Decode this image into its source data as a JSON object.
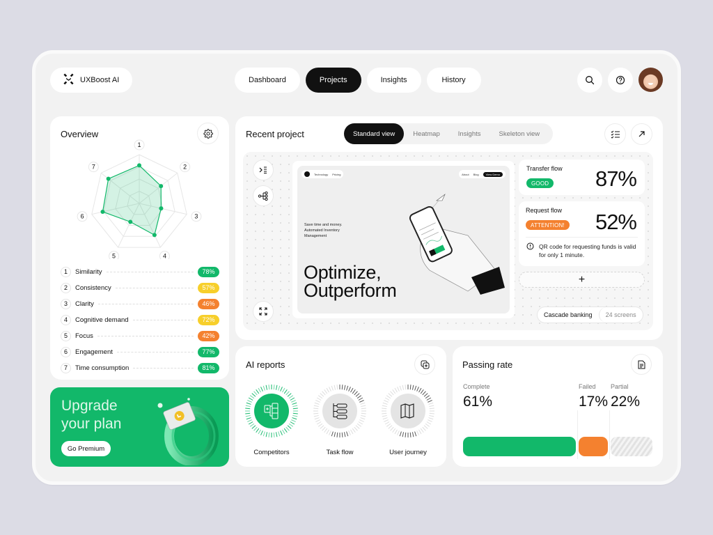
{
  "header": {
    "brand": "UXBoost AI",
    "nav": [
      {
        "label": "Dashboard",
        "active": false
      },
      {
        "label": "Projects",
        "active": true
      },
      {
        "label": "Insights",
        "active": false
      },
      {
        "label": "History",
        "active": false
      }
    ],
    "icons": [
      "search-icon",
      "help-icon",
      "avatar"
    ]
  },
  "overview": {
    "title": "Overview",
    "settings_icon": "gear-icon",
    "axes": [
      "1",
      "2",
      "3",
      "4",
      "5",
      "6",
      "7"
    ],
    "metrics": [
      {
        "n": "1",
        "label": "Similarity",
        "value": "78%",
        "level": 0.78,
        "color": "#12b86a"
      },
      {
        "n": "2",
        "label": "Consistency",
        "value": "57%",
        "level": 0.57,
        "color": "#f7cf2b"
      },
      {
        "n": "3",
        "label": "Clarity",
        "value": "46%",
        "level": 0.46,
        "color": "#f4812f"
      },
      {
        "n": "4",
        "label": "Cognitive demand",
        "value": "72%",
        "level": 0.72,
        "color": "#f7cf2b"
      },
      {
        "n": "5",
        "label": "Focus",
        "value": "42%",
        "level": 0.42,
        "color": "#f4812f"
      },
      {
        "n": "6",
        "label": "Engagement",
        "value": "77%",
        "level": 0.77,
        "color": "#12b86a"
      },
      {
        "n": "7",
        "label": "Time consumption",
        "value": "81%",
        "level": 0.81,
        "color": "#12b86a"
      }
    ]
  },
  "upgrade": {
    "line1": "Upgrade",
    "line2": "your plan",
    "button": "Go Premium"
  },
  "recent_project": {
    "title": "Recent project",
    "tabs": [
      {
        "label": "Standard view",
        "active": true
      },
      {
        "label": "Heatmap",
        "active": false
      },
      {
        "label": "Insights",
        "active": false
      },
      {
        "label": "Skeleton view",
        "active": false
      }
    ],
    "preview": {
      "nav_left": [
        "Technology",
        "Pricing"
      ],
      "nav_right": [
        "About",
        "Blog"
      ],
      "cta": "View Demo",
      "tagline": [
        "Save time and money.",
        "Automated Inventory",
        "Management"
      ],
      "headline1": "Optimize,",
      "headline2": "Outperform"
    },
    "flows": [
      {
        "name": "Transfer flow",
        "status": "GOOD",
        "status_color": "#12b86a",
        "value": "87%"
      },
      {
        "name": "Request flow",
        "status": "ATTENTION!",
        "status_color": "#f4812f",
        "value": "52%",
        "note": "QR code for requesting funds is valid for only 1 minute."
      }
    ],
    "add_label": "+",
    "project_name": "Cascade banking",
    "screens": "24 screens"
  },
  "ai_reports": {
    "title": "AI reports",
    "items": [
      {
        "label": "Competitors",
        "active": true
      },
      {
        "label": "Task flow",
        "active": false
      },
      {
        "label": "User journey",
        "active": false
      }
    ]
  },
  "passing_rate": {
    "title": "Passing rate",
    "segments": [
      {
        "label": "Complete",
        "value": "61%",
        "share": 0.61,
        "color": "#12b86a"
      },
      {
        "label": "Failed",
        "value": "17%",
        "share": 0.17,
        "color": "#f4812f"
      },
      {
        "label": "Partial",
        "value": "22%",
        "share": 0.22,
        "color": "#e4e4e4"
      }
    ]
  },
  "colors": {
    "accent": "#12b86a",
    "warning": "#f4812f",
    "caution": "#f7cf2b",
    "dark": "#111111"
  }
}
